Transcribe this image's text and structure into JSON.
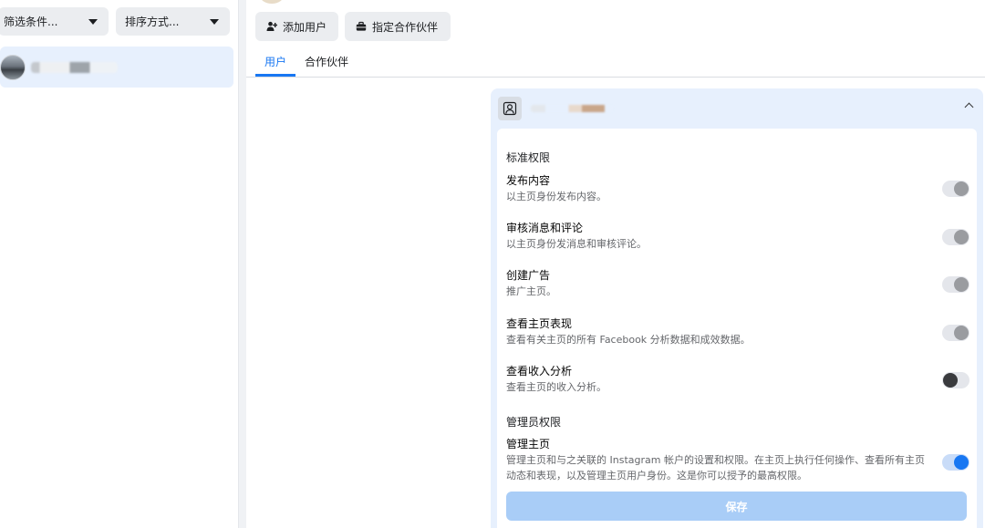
{
  "sidebar": {
    "filter_label": "筛选条件...",
    "sort_label": "排序方式..."
  },
  "actions": {
    "add_user": "添加用户",
    "assign_partner": "指定合作伙伴"
  },
  "tabs": [
    {
      "label": "用户",
      "active": true
    },
    {
      "label": "合作伙伴",
      "active": false
    }
  ],
  "permissions": {
    "standard_title": "标准权限",
    "items": [
      {
        "title": "发布内容",
        "desc": "以主页身份发布内容。",
        "state": "on-disabled"
      },
      {
        "title": "审核消息和评论",
        "desc": "以主页身份发消息和审核评论。",
        "state": "on-disabled"
      },
      {
        "title": "创建广告",
        "desc": "推广主页。",
        "state": "on-disabled"
      },
      {
        "title": "查看主页表现",
        "desc": "查看有关主页的所有 Facebook 分析数据和成效数据。",
        "state": "on-disabled"
      },
      {
        "title": "查看收入分析",
        "desc": "查看主页的收入分析。",
        "state": "off"
      }
    ],
    "admin_title": "管理员权限",
    "admin_item": {
      "title": "管理主页",
      "desc": "管理主页和与之关联的 Instagram 帐户的设置和权限。在主页上执行任何操作、查看所有主页动态和表现，以及管理主页用户身份。这是你可以授予的最高权限。",
      "state": "on"
    },
    "save_label": "保存"
  },
  "colors": {
    "accent": "#1877f2",
    "save_disabled": "#a9cdf7",
    "selected_bg": "#e7f0fd"
  }
}
